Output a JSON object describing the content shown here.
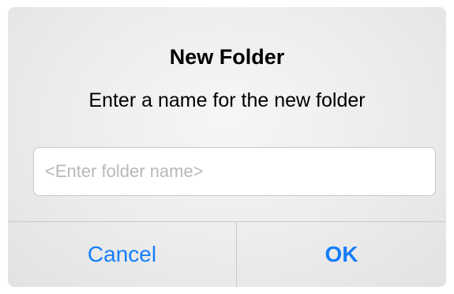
{
  "dialog": {
    "title": "New Folder",
    "message": "Enter a name for the new folder",
    "input": {
      "value": "",
      "placeholder": "<Enter folder name>"
    },
    "buttons": {
      "cancel_label": "Cancel",
      "ok_label": "OK"
    },
    "colors": {
      "accent": "#157efb",
      "background": "#ececec",
      "divider": "#c9c9c9",
      "placeholder": "#b8b8bc"
    }
  }
}
